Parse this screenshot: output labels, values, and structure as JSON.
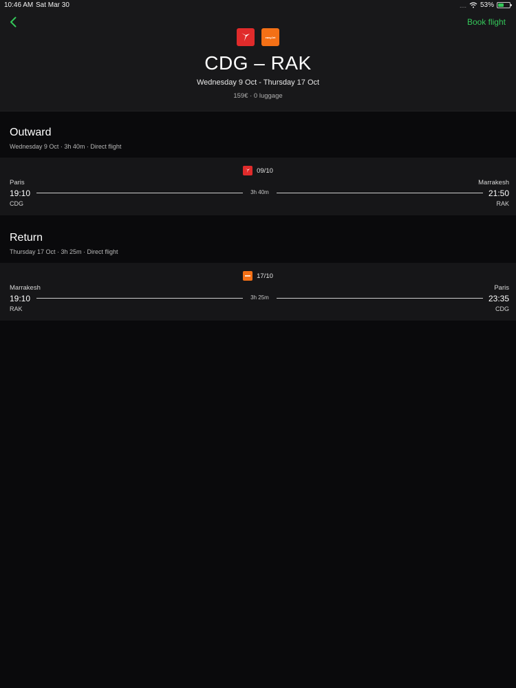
{
  "status_bar": {
    "time": "10:46 AM",
    "date": "Sat Mar 30",
    "signal": "....",
    "battery": "53%",
    "battery_level": 0.53
  },
  "header": {
    "back_icon": "chevron-left-icon",
    "book_label": "Book flight",
    "title": "CDG – RAK",
    "dates": "Wednesday 9 Oct - Thursday 17 Oct",
    "meta": "159€ · 0 luggage",
    "logo_orange_text": "easyJet"
  },
  "outward": {
    "title": "Outward",
    "subtitle": "Wednesday 9 Oct · 3h 40m · Direct flight",
    "card": {
      "date": "09/10",
      "from_city": "Paris",
      "to_city": "Marrakesh",
      "dep_time": "19:10",
      "arr_time": "21:50",
      "duration": "3h 40m",
      "from_code": "CDG",
      "to_code": "RAK"
    }
  },
  "return": {
    "title": "Return",
    "subtitle": "Thursday 17 Oct · 3h 25m · Direct flight",
    "card": {
      "date": "17/10",
      "from_city": "Marrakesh",
      "to_city": "Paris",
      "dep_time": "19:10",
      "arr_time": "23:35",
      "duration": "3h 25m",
      "from_code": "RAK",
      "to_code": "CDG"
    }
  },
  "colors": {
    "accent": "#34c759",
    "airline_red": "#e02b2b",
    "airline_orange": "#f47016",
    "background": "#0a0a0c",
    "surface": "#161618"
  }
}
